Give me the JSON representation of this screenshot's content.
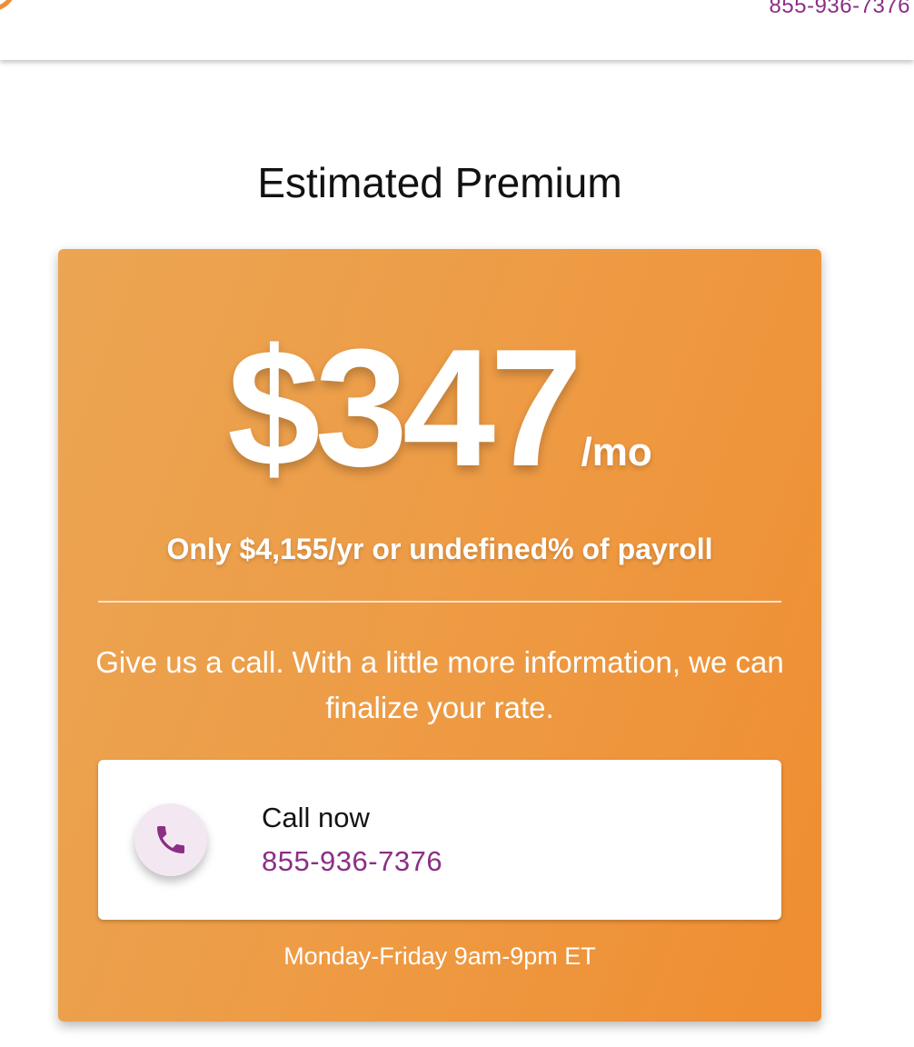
{
  "header": {
    "phone": "855-936-7376"
  },
  "main": {
    "title": "Estimated Premium"
  },
  "premium": {
    "amount": "$347",
    "period": "/mo",
    "annual": "Only $4,155/yr or undefined% of payroll",
    "callout": "Give us a call. With a little more information, we can finalize your rate.",
    "call_label": "Call now",
    "call_number": "855-936-7376",
    "hours": "Monday-Friday 9am-9pm ET",
    "icon": "phone-icon"
  },
  "colors": {
    "brand_orange": "#ef8f34",
    "brand_purple": "#8b2f86",
    "phone_circle_bg": "#f3e8f1"
  }
}
